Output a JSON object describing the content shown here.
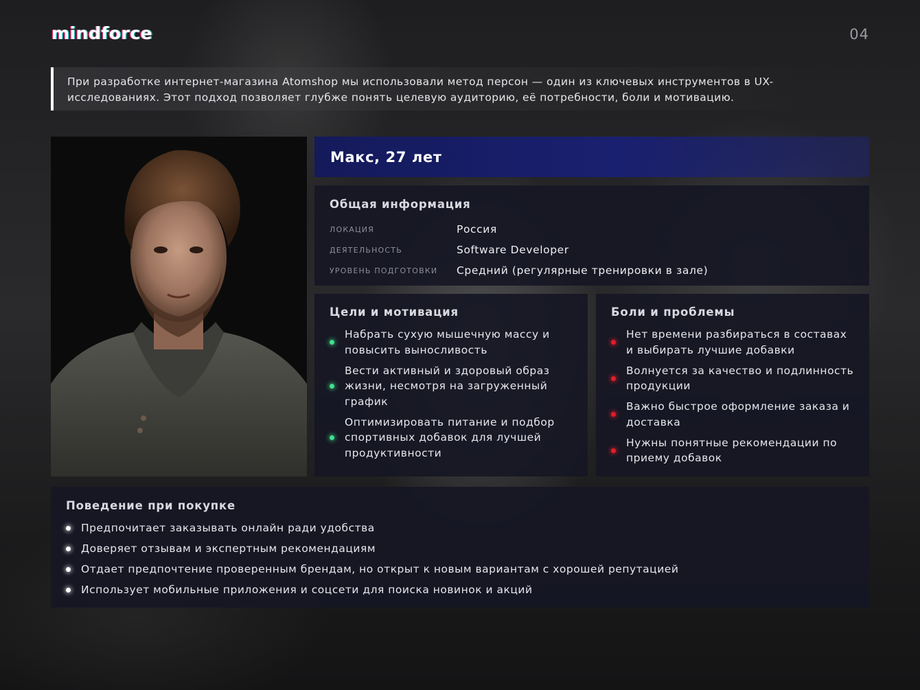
{
  "brand": {
    "logo_text": "mindforce",
    "page_number": "04"
  },
  "intro": {
    "text": "При разработке интернет-магазина Atomshop мы использовали метод персон — один из ключевых инструментов в UX-исследованиях. Этот подход позволяет глубже понять целевую аудиторию, её потребности, боли и мотивацию."
  },
  "persona": {
    "name": "Макс, 27 лет"
  },
  "general": {
    "title": "Общая информация",
    "rows": [
      {
        "key": "ЛОКАЦИЯ",
        "value": "Россия"
      },
      {
        "key": "ДЕЯТЕЛЬНОСТЬ",
        "value": "Software Developer"
      },
      {
        "key": "УРОВЕНЬ ПОДГОТОВКИ",
        "value": "Средний (регулярные тренировки в зале)"
      }
    ]
  },
  "goals": {
    "title": "Цели и мотивация",
    "items": [
      "Набрать сухую мышечную массу и повысить выносливость",
      "Вести активный и здоровый образ жизни, несмотря на загруженный график",
      "Оптимизировать питание и подбор спортивных добавок для лучшей продуктивности"
    ]
  },
  "pains": {
    "title": "Боли и проблемы",
    "items": [
      "Нет времени разбираться в составах и выбирать лучшие добавки",
      "Волнуется за качество и подлинность продукции",
      "Важно быстрое оформление заказа и доставка",
      "Нужны понятные рекомендации по приему добавок"
    ]
  },
  "behavior": {
    "title": "Поведение при покупке",
    "items": [
      "Предпочитает заказывать онлайн ради удобства",
      "Доверяет отзывам и экспертным рекомендациям",
      "Отдает предпочтение проверенным брендам, но открыт к новым вариантам с хорошей репутацией",
      "Использует мобильные приложения и соцсети для поиска новинок и акций"
    ]
  },
  "colors": {
    "accent_banner": "#1a2070",
    "goal_bullet": "#3fe08a",
    "pain_bullet": "#e01e2a",
    "behavior_bullet": "#ffffff"
  }
}
